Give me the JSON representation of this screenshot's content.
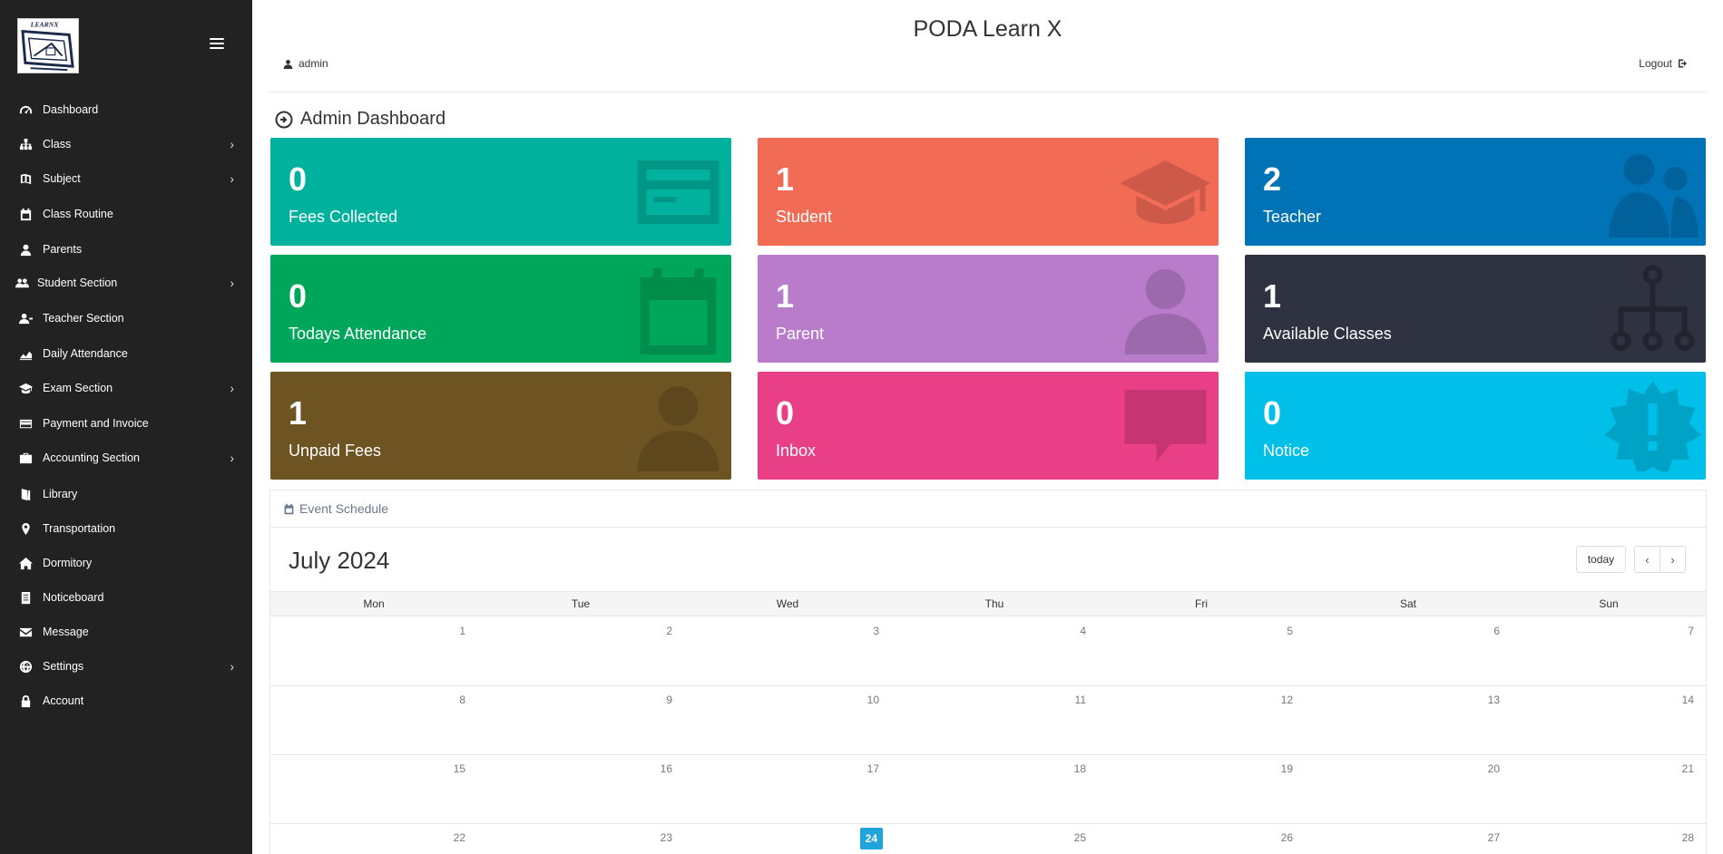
{
  "app": {
    "title": "PODA Learn X",
    "logo_text": "LEARNX"
  },
  "user": {
    "name": "admin"
  },
  "logout_label": "Logout",
  "page_title": "Admin Dashboard",
  "sidebar": {
    "items": [
      {
        "label": "Dashboard",
        "icon": "dashboard-icon",
        "has_submenu": false
      },
      {
        "label": "Class",
        "icon": "sitemap-icon",
        "has_submenu": true
      },
      {
        "label": "Subject",
        "icon": "book-icon",
        "has_submenu": true
      },
      {
        "label": "Class Routine",
        "icon": "calendar-icon",
        "has_submenu": false
      },
      {
        "label": "Parents",
        "icon": "user-icon",
        "has_submenu": false
      },
      {
        "label": "Student Section",
        "icon": "users-icon",
        "has_submenu": true
      },
      {
        "label": "Teacher Section",
        "icon": "teacher-icon",
        "has_submenu": false
      },
      {
        "label": "Daily Attendance",
        "icon": "chart-icon",
        "has_submenu": false
      },
      {
        "label": "Exam Section",
        "icon": "graduation-cap-icon",
        "has_submenu": true
      },
      {
        "label": "Payment and Invoice",
        "icon": "credit-card-icon",
        "has_submenu": false
      },
      {
        "label": "Accounting Section",
        "icon": "briefcase-icon",
        "has_submenu": true
      },
      {
        "label": "Library",
        "icon": "library-icon",
        "has_submenu": false
      },
      {
        "label": "Transportation",
        "icon": "map-marker-icon",
        "has_submenu": false
      },
      {
        "label": "Dormitory",
        "icon": "home-icon",
        "has_submenu": false
      },
      {
        "label": "Noticeboard",
        "icon": "notice-icon",
        "has_submenu": false
      },
      {
        "label": "Message",
        "icon": "envelope-icon",
        "has_submenu": false
      },
      {
        "label": "Settings",
        "icon": "globe-icon",
        "has_submenu": true
      },
      {
        "label": "Account",
        "icon": "lock-icon",
        "has_submenu": false
      }
    ]
  },
  "tiles": [
    {
      "value": "0",
      "label": "Fees Collected",
      "color": "#00b29e",
      "icon": "credit-card-icon"
    },
    {
      "value": "1",
      "label": "Student",
      "color": "#f26b55",
      "icon": "graduation-cap-icon"
    },
    {
      "value": "2",
      "label": "Teacher",
      "color": "#0073b7",
      "icon": "users-icon"
    },
    {
      "value": "0",
      "label": "Todays Attendance",
      "color": "#00a65a",
      "icon": "calendar-icon"
    },
    {
      "value": "1",
      "label": "Parent",
      "color": "#b87ccb",
      "icon": "user-icon"
    },
    {
      "value": "1",
      "label": "Available Classes",
      "color": "#2e3241",
      "icon": "sitemap-icon"
    },
    {
      "value": "1",
      "label": "Unpaid Fees",
      "color": "#6f5423",
      "icon": "user-icon"
    },
    {
      "value": "0",
      "label": "Inbox",
      "color": "#e93f86",
      "icon": "comment-icon"
    },
    {
      "value": "0",
      "label": "Notice",
      "color": "#00bfe8",
      "icon": "certificate-icon"
    }
  ],
  "calendar": {
    "panel_title": "Event Schedule",
    "month_label": "July 2024",
    "today_label": "today",
    "prev_label": "‹",
    "next_label": "›",
    "day_names": [
      "Mon",
      "Tue",
      "Wed",
      "Thu",
      "Fri",
      "Sat",
      "Sun"
    ],
    "weeks": [
      [
        "1",
        "2",
        "3",
        "4",
        "5",
        "6",
        "7"
      ],
      [
        "8",
        "9",
        "10",
        "11",
        "12",
        "13",
        "14"
      ],
      [
        "15",
        "16",
        "17",
        "18",
        "19",
        "20",
        "21"
      ],
      [
        "22",
        "23",
        "24",
        "25",
        "26",
        "27",
        "28"
      ]
    ],
    "today": "24",
    "today_color": "#20a4dc"
  }
}
